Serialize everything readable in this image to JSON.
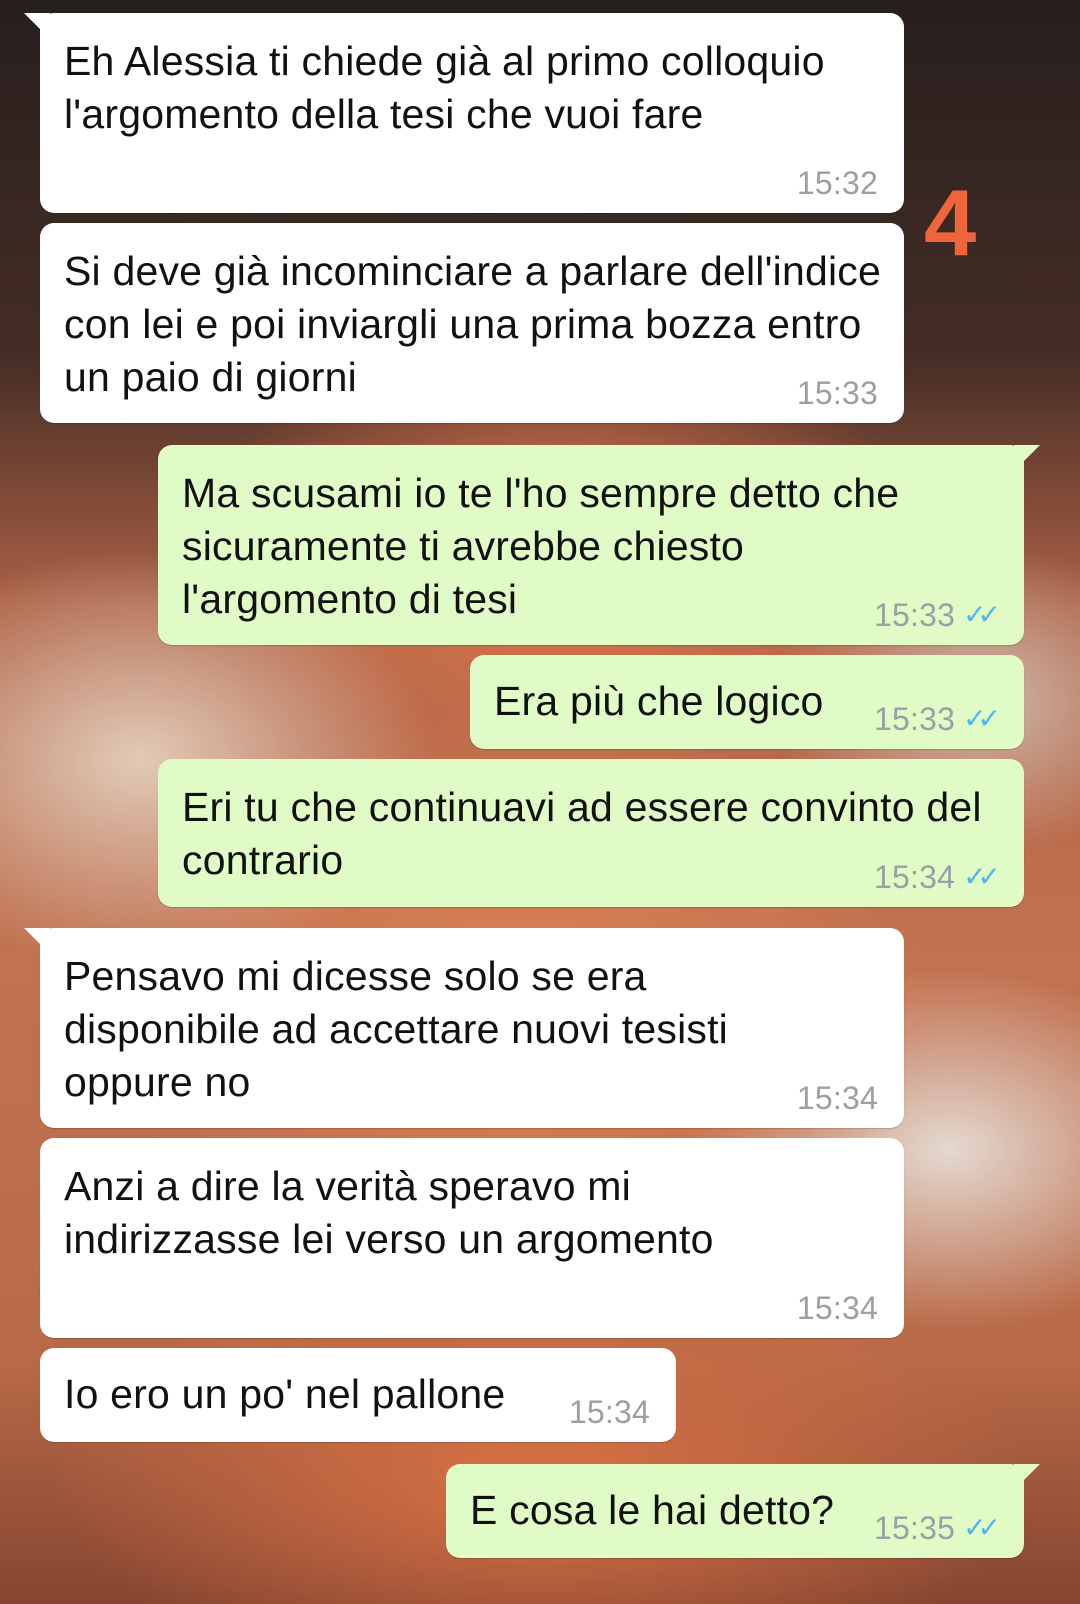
{
  "page_number": "4",
  "messages": [
    {
      "text": "Eh Alessia ti chiede già al primo colloquio l'argomento della tesi che vuoi fare",
      "time": "15:32",
      "direction": "incoming",
      "read_status": ""
    },
    {
      "text": "Si deve già incominciare a parlare dell'indice con lei e poi inviargli una prima bozza entro un paio di giorni",
      "time": "15:33",
      "direction": "incoming",
      "read_status": ""
    },
    {
      "text": "Ma scusami io te l'ho sempre detto che sicuramente ti avrebbe chiesto l'argomento di tesi",
      "time": "15:33",
      "direction": "outgoing",
      "read_status": "read"
    },
    {
      "text": "Era più che logico",
      "time": "15:33",
      "direction": "outgoing",
      "read_status": "read"
    },
    {
      "text": "Eri tu che continuavi ad essere convinto del contrario",
      "time": "15:34",
      "direction": "outgoing",
      "read_status": "read"
    },
    {
      "text": "Pensavo mi dicesse solo se era disponibile ad accettare nuovi tesisti oppure no",
      "time": "15:34",
      "direction": "incoming",
      "read_status": ""
    },
    {
      "text": "Anzi a dire la verità speravo mi indirizzasse lei verso un argomento",
      "time": "15:34",
      "direction": "incoming",
      "read_status": ""
    },
    {
      "text": "Io ero un po' nel pallone",
      "time": "15:34",
      "direction": "incoming",
      "read_status": ""
    },
    {
      "text": "E cosa le hai detto?",
      "time": "15:35",
      "direction": "outgoing",
      "read_status": "read"
    }
  ],
  "icons": {
    "read_receipt": "double-check-icon"
  },
  "colors": {
    "incoming_bubble": "#ffffff",
    "outgoing_bubble": "#e1fbc6",
    "read_tick": "#4fb6ec",
    "timestamp": "#9aa0a3",
    "page_number": "#f0643c"
  }
}
